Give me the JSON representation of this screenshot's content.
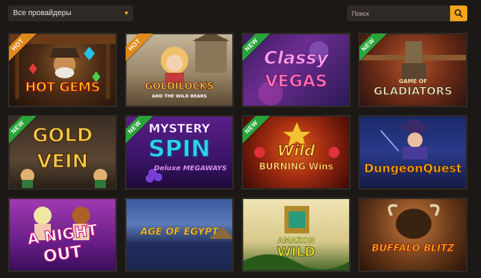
{
  "filters": {
    "provider_select_value": "Все провайдеры",
    "search_placeholder": "Поиск"
  },
  "games": [
    {
      "title": "HOT GEMS",
      "badge": "HOT"
    },
    {
      "title": "GOLDILOCKS",
      "subtitle": "AND THE WILD BEARS",
      "badge": "HOT"
    },
    {
      "title": "Classy",
      "subtitle": "VEGAS",
      "badge": "NEW"
    },
    {
      "title": "GAME OF",
      "subtitle": "GLADIATORS",
      "badge": "NEW"
    },
    {
      "title": "GOLD",
      "subtitle": "VEIN",
      "badge": "NEW"
    },
    {
      "title": "MYSTERY",
      "subtitle": "SPIN",
      "extra": "Deluxe MEGAWAYS",
      "badge": "NEW"
    },
    {
      "title": "Wild",
      "subtitle": "BURNING Wins",
      "badge": "NEW"
    },
    {
      "title": "DungeonQuest"
    },
    {
      "title": "A NIGHT",
      "subtitle": "OUT"
    },
    {
      "title": "AGE OF EGYPT"
    },
    {
      "title": "AMAZON",
      "subtitle": "WILD"
    },
    {
      "title": "BUFFALO BLITZ"
    }
  ],
  "colors": {
    "background": "#1c1815",
    "accent": "#f2a51a",
    "hot_badge": "#e08a18",
    "new_badge": "#29a43a"
  },
  "icons": {
    "search": "magnifier",
    "select": "caret-down"
  }
}
